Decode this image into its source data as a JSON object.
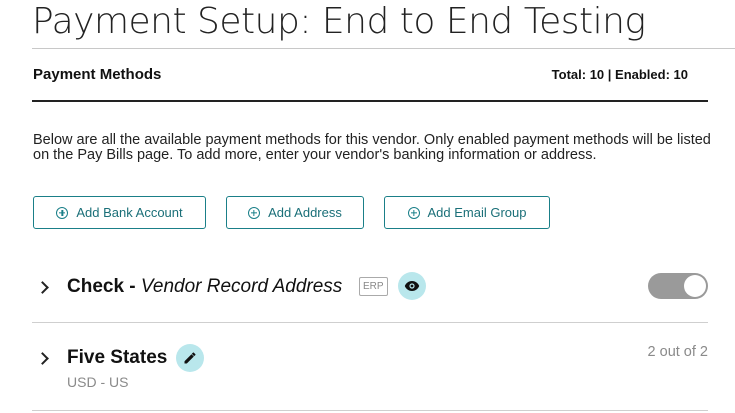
{
  "page": {
    "title": "Payment Setup: End to End Testing"
  },
  "section": {
    "title": "Payment Methods",
    "counts": "Total: 10 | Enabled: 10",
    "description": "Below are all the available payment methods for this vendor. Only enabled payment methods will be listed on the Pay Bills page. To add more, enter your vendor's banking information or address."
  },
  "buttons": {
    "add_bank_account": "Add Bank Account",
    "add_address": "Add Address",
    "add_email_group": "Add Email Group"
  },
  "methods": [
    {
      "name": "Check -",
      "detail": "Vendor Record Address",
      "badge": "ERP",
      "enabled": true
    },
    {
      "name": "Five States",
      "sub": "USD - US",
      "count": "2 out of 2"
    }
  ],
  "colors": {
    "accent": "#1a7f88",
    "accent_light": "#b9e7ec",
    "toggle_bg": "#9a9a9a"
  }
}
